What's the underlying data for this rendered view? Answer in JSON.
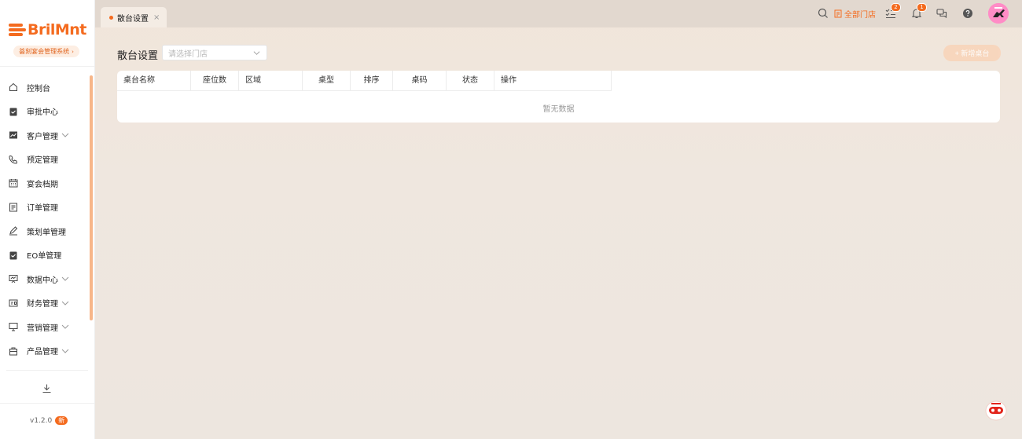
{
  "brand": {
    "logo_text": "BrilMnt",
    "system_name": "荟刻宴会管理系统"
  },
  "sidebar": {
    "items": [
      {
        "label": "控制台",
        "icon": "home-icon",
        "expandable": false
      },
      {
        "label": "审批中心",
        "icon": "clipboard-check-icon",
        "expandable": false
      },
      {
        "label": "客户管理",
        "icon": "chart-line-icon",
        "expandable": true
      },
      {
        "label": "预定管理",
        "icon": "phone-icon",
        "expandable": false
      },
      {
        "label": "宴会档期",
        "icon": "calendar-icon",
        "expandable": false
      },
      {
        "label": "订单管理",
        "icon": "document-icon",
        "expandable": false
      },
      {
        "label": "策划单管理",
        "icon": "pen-icon",
        "expandable": false
      },
      {
        "label": "EO单管理",
        "icon": "clipboard-check-icon",
        "expandable": false
      },
      {
        "label": "数据中心",
        "icon": "presentation-icon",
        "expandable": true
      },
      {
        "label": "财务管理",
        "icon": "wallet-icon",
        "expandable": true
      },
      {
        "label": "营销管理",
        "icon": "monitor-icon",
        "expandable": true
      },
      {
        "label": "产品管理",
        "icon": "bag-icon",
        "expandable": true
      }
    ],
    "version": "v1.2.0",
    "new_badge": "新"
  },
  "tabs": [
    {
      "label": "散台设置",
      "active": true
    }
  ],
  "topbar": {
    "store_selector": "全部门店",
    "todo_badge": "2",
    "notification_badge": "1"
  },
  "page": {
    "title": "散台设置",
    "store_placeholder": "请选择门店",
    "add_button": "+ 新增桌台"
  },
  "table": {
    "columns": [
      "桌台名称",
      "座位数",
      "区域",
      "桌型",
      "排序",
      "桌码",
      "状态",
      "操作"
    ],
    "rows": [],
    "empty_text": "暂无数据"
  },
  "colors": {
    "accent": "#f46b1f",
    "sidebar_scroll": "#f7b689"
  }
}
